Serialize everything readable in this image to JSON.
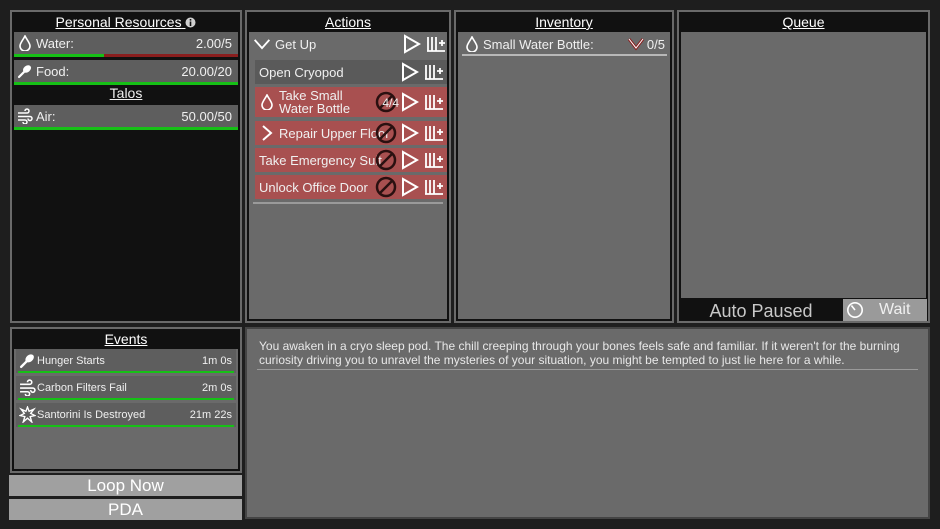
{
  "resources_panel": {
    "title": "Personal Resources",
    "info_icon": "info-icon",
    "resources": [
      {
        "icon": "water-drop-icon",
        "label": "Water:",
        "value": "2.00/5",
        "fill": 0.4
      },
      {
        "icon": "food-icon",
        "label": "Food:",
        "value": "20.00/20",
        "fill": 1.0
      }
    ],
    "talos_title": "Talos",
    "talos": [
      {
        "icon": "air-icon",
        "label": "Air:",
        "value": "50.00/50",
        "fill": 1.0
      }
    ]
  },
  "actions_panel": {
    "title": "Actions",
    "group_label": "Get Up",
    "items": [
      {
        "label": "Open Cryopod",
        "state": "available"
      },
      {
        "label": "Take Small Water Bottle",
        "count": "4/4",
        "state": "blocked",
        "icon": "water-drop-icon"
      },
      {
        "label": "Repair Upper Floor",
        "state": "blocked",
        "icon": "chevron-right-icon"
      },
      {
        "label": "Take Emergency Suit",
        "state": "blocked"
      },
      {
        "label": "Unlock Office Door",
        "state": "blocked"
      }
    ]
  },
  "inventory_panel": {
    "title": "Inventory",
    "items": [
      {
        "icon": "water-drop-icon",
        "label": "Small Water Bottle:",
        "value": "0/5"
      }
    ]
  },
  "queue_panel": {
    "title": "Queue",
    "status": "Auto Paused",
    "wait_label": "Wait"
  },
  "events_panel": {
    "title": "Events",
    "events": [
      {
        "icon": "food-icon",
        "label": "Hunger Starts",
        "time": "1m 0s"
      },
      {
        "icon": "air-icon",
        "label": "Carbon Filters Fail",
        "time": "2m 0s"
      },
      {
        "icon": "explosion-icon",
        "label": "Santorini Is Destroyed",
        "time": "21m 22s"
      }
    ]
  },
  "buttons": {
    "loop_now": "Loop Now",
    "pda": "PDA"
  },
  "log": {
    "text": "You awaken in a cryo sleep pod. The chill creeping through your bones feels safe and familiar. If it weren't for the burning curiosity driving you to unravel the mysteries of your situation, you might be tempted to just lie here for a while."
  },
  "colors": {
    "background": "#1e1e1e",
    "panel": "#111111",
    "inner": "#6a6a6a",
    "row": "#5e5e5e",
    "blocked_action": "#a85050",
    "bar_full": "#16c016",
    "bar_empty": "#8a1e1e"
  }
}
